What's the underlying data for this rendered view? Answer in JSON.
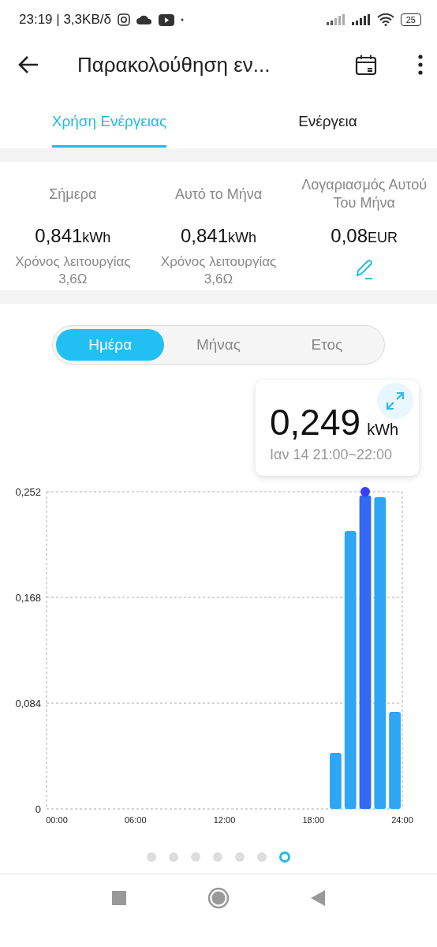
{
  "status_bar": {
    "time": "23:19 | 3,3KB/δ",
    "battery": "25"
  },
  "app_bar": {
    "title": "Παρακολούθηση εν..."
  },
  "tabs": [
    {
      "label": "Χρήση Ενέργειας",
      "selected": true
    },
    {
      "label": "Ενέργεια",
      "selected": false
    }
  ],
  "stats": [
    {
      "label": "Σήμερα",
      "value": "0,841",
      "unit": "kWh",
      "note": "Χρόνος λειτουργίας 3,6Ω",
      "kind": "note"
    },
    {
      "label": "Αυτό το Μήνα",
      "value": "0,841",
      "unit": "kWh",
      "note": "Χρόνος λειτουργίας 3,6Ω",
      "kind": "note"
    },
    {
      "label": "Λογαριασμός Αυτού Του Μήνα",
      "value": "0,08",
      "unit": "EUR",
      "kind": "edit"
    }
  ],
  "periods": [
    {
      "label": "Ημέρα",
      "selected": true
    },
    {
      "label": "Μήνας",
      "selected": false
    },
    {
      "label": "Ετος",
      "selected": false
    }
  ],
  "tooltip": {
    "value": "0,249",
    "unit": "kWh",
    "time": "Ιαν 14 21:00~22:00"
  },
  "chart_data": {
    "type": "bar",
    "x": [
      19.5,
      20.5,
      21.5,
      22.5,
      23.5
    ],
    "series": [
      {
        "color": "#2ea6f5",
        "values": [
          0.0445,
          0.2207,
          null,
          0.2476,
          0.0771
        ]
      },
      {
        "color": "#3368f2",
        "values": [
          null,
          null,
          0.249,
          null,
          null
        ]
      }
    ],
    "xlim": [
      0,
      24
    ],
    "ylim": [
      0,
      0.252
    ],
    "xticks": [
      {
        "value": 0,
        "label": "00:00"
      },
      {
        "value": 6,
        "label": "06:00"
      },
      {
        "value": 12,
        "label": "12:00"
      },
      {
        "value": 18,
        "label": "18:00"
      },
      {
        "value": 24,
        "label": "24:00"
      }
    ],
    "yticks": [
      {
        "value": 0,
        "label": "0"
      },
      {
        "value": 0.084,
        "label": "0,084"
      },
      {
        "value": 0.168,
        "label": "0,168"
      },
      {
        "value": 0.252,
        "label": "0,252"
      }
    ]
  },
  "pager": [
    {
      "selected": false
    },
    {
      "selected": false
    },
    {
      "selected": false
    },
    {
      "selected": false
    },
    {
      "selected": false
    },
    {
      "selected": false
    },
    {
      "selected": true
    }
  ]
}
